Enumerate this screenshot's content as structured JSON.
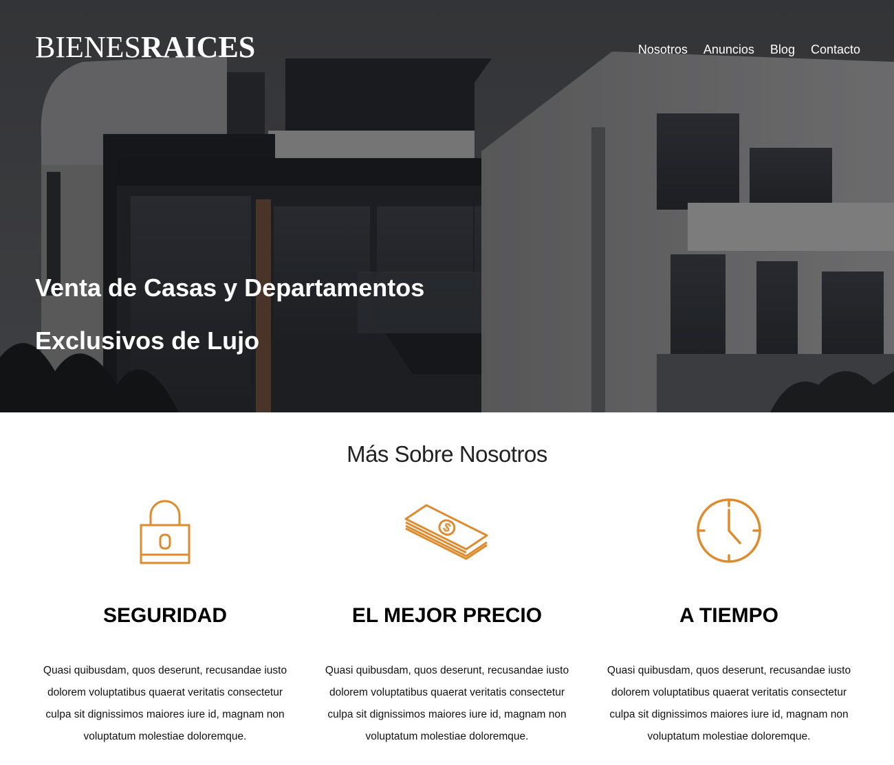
{
  "header": {
    "logo_light": "BIENES",
    "logo_bold": "RAICES",
    "nav": [
      "Nosotros",
      "Anuncios",
      "Blog",
      "Contacto"
    ]
  },
  "hero": {
    "title_line1": "Venta de Casas y Departamentos",
    "title_line2": "Exclusivos de Lujo"
  },
  "about": {
    "title": "Más Sobre Nosotros",
    "features": [
      {
        "icon": "lock-icon",
        "heading": "SEGURIDAD",
        "text": "Quasi quibusdam, quos deserunt, recusandae iusto dolorem voluptatibus quaerat veritatis consectetur culpa sit dignissimos maiores iure id, magnam non voluptatum molestiae doloremque."
      },
      {
        "icon": "money-icon",
        "heading": "EL MEJOR PRECIO",
        "text": "Quasi quibusdam, quos deserunt, recusandae iusto dolorem voluptatibus quaerat veritatis consectetur culpa sit dignissimos maiores iure id, magnam non voluptatum molestiae doloremque."
      },
      {
        "icon": "clock-icon",
        "heading": "A TIEMPO",
        "text": "Quasi quibusdam, quos deserunt, recusandae iusto dolorem voluptatibus quaerat veritatis consectetur culpa sit dignissimos maiores iure id, magnam non voluptatum molestiae doloremque."
      }
    ]
  },
  "colors": {
    "accent": "#e08a2e",
    "hero_sky": "#4a4c52",
    "text": "#000000"
  }
}
